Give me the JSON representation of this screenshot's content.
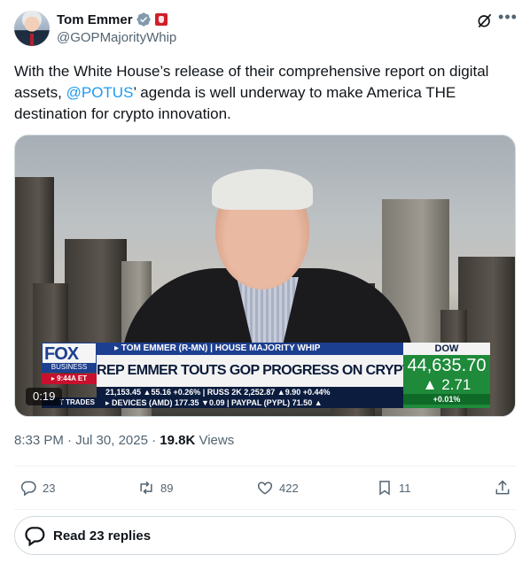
{
  "author": {
    "name": "Tom Emmer",
    "handle": "@GOPMajorityWhip"
  },
  "tweet": {
    "text_before": "With the White House’s release of their comprehensive report on digital assets, ",
    "mention": "@POTUS",
    "text_after": "’ agenda is well underway to make America THE destination for crypto innovation."
  },
  "media": {
    "duration": "0:19",
    "lower_third": {
      "logo": "FOX",
      "logo_sub": "BUSINESS",
      "time": "▸ 9:44A ET",
      "strip": "▸ TOM EMMER (R-MN) | HOUSE MAJORITY WHIP",
      "headline": "REP EMMER TOUTS GOP PROGRESS ON CRYPTOCURRENCY",
      "ticker_line1": "21,153.45 ▲55.16 +0.26% | RUSS 2K   2,252.87 ▲9.90 +0.44%",
      "ticker_line2": "▸ DEVICES (AMD)  177.35  ▼0.09  |  PAYPAL (PYPL)  71.50 ▲",
      "ticker_label": "T TRADES",
      "index_label": "DOW",
      "index_value": "44,635.70",
      "index_change": "▲ 2.71",
      "index_pct": "+0.01%"
    }
  },
  "meta": {
    "time": "8:33 PM",
    "separator1": " · ",
    "date": "Jul 30, 2025",
    "separator2": " · ",
    "views_count": "19.8K",
    "views_label": " Views"
  },
  "actions": {
    "replies": "23",
    "reposts": "89",
    "likes": "422",
    "bookmarks": "11"
  },
  "read_replies_label": "Read 23 replies",
  "colors": {
    "accent": "#1d9bf0",
    "text": "#0f1419",
    "secondary": "#536471",
    "border": "#cfd9de",
    "verified": "#829aab"
  }
}
